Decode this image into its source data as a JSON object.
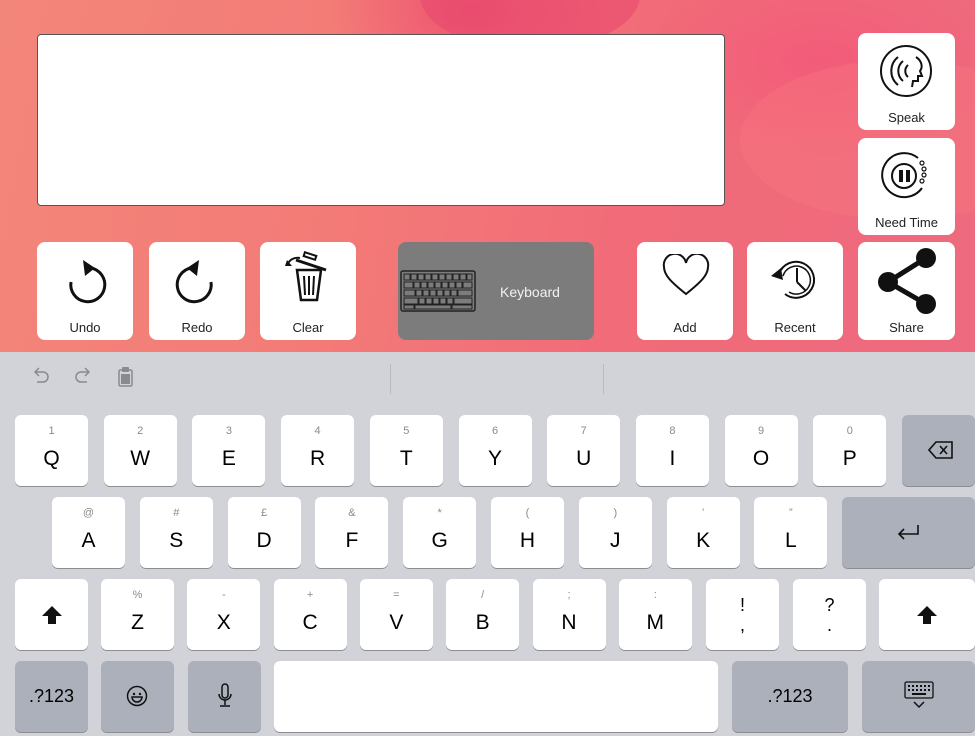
{
  "app": {
    "message_text": "",
    "side_buttons": {
      "speak": "Speak",
      "need_time": "Need Time"
    },
    "toolbar": {
      "undo": "Undo",
      "redo": "Redo",
      "clear": "Clear",
      "keyboard": "Keyboard",
      "add": "Add",
      "recent": "Recent",
      "share": "Share"
    }
  },
  "keyboard": {
    "row1": [
      {
        "hint": "1",
        "key": "Q"
      },
      {
        "hint": "2",
        "key": "W"
      },
      {
        "hint": "3",
        "key": "E"
      },
      {
        "hint": "4",
        "key": "R"
      },
      {
        "hint": "5",
        "key": "T"
      },
      {
        "hint": "6",
        "key": "Y"
      },
      {
        "hint": "7",
        "key": "U"
      },
      {
        "hint": "8",
        "key": "I"
      },
      {
        "hint": "9",
        "key": "O"
      },
      {
        "hint": "0",
        "key": "P"
      }
    ],
    "row2": [
      {
        "hint": "@",
        "key": "A"
      },
      {
        "hint": "#",
        "key": "S"
      },
      {
        "hint": "£",
        "key": "D"
      },
      {
        "hint": "&",
        "key": "F"
      },
      {
        "hint": "*",
        "key": "G"
      },
      {
        "hint": "(",
        "key": "H"
      },
      {
        "hint": ")",
        "key": "J"
      },
      {
        "hint": "’",
        "key": "K"
      },
      {
        "hint": "”",
        "key": "L"
      }
    ],
    "row3": [
      {
        "hint": "%",
        "key": "Z"
      },
      {
        "hint": "-",
        "key": "X"
      },
      {
        "hint": "+",
        "key": "C"
      },
      {
        "hint": "=",
        "key": "V"
      },
      {
        "hint": "/",
        "key": "B"
      },
      {
        "hint": ";",
        "key": "N"
      },
      {
        "hint": ":",
        "key": "M"
      }
    ],
    "punct": [
      {
        "top": "!",
        "bottom": ","
      },
      {
        "top": "?",
        "bottom": "."
      }
    ],
    "bottom": {
      "numbers_left": ".?123",
      "numbers_right": ".?123"
    }
  }
}
